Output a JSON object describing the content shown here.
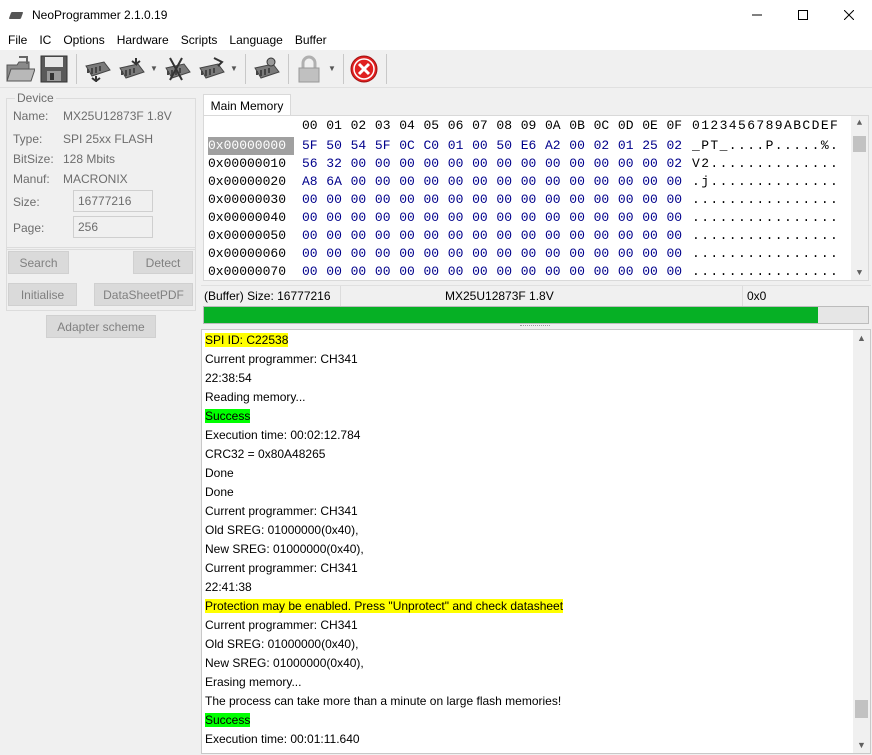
{
  "window": {
    "title": "NeoProgrammer 2.1.0.19"
  },
  "menu": [
    "File",
    "IC",
    "Options",
    "Hardware",
    "Scripts",
    "Language",
    "Buffer"
  ],
  "toolbar_icons": [
    "open-folder-icon",
    "save-icon",
    "read-chip-icon",
    "write-chip-icon",
    "verify-chip-icon",
    "erase-chip-icon",
    "chip-gear-icon",
    "unprotect-lock-icon",
    "stop-icon"
  ],
  "device": {
    "legend": "Device",
    "name_label": "Name:",
    "name": "MX25U12873F 1.8V",
    "type_label": "Type:",
    "type": "SPI 25xx FLASH",
    "bitsize_label": "BitSize:",
    "bitsize": "128 Mbits",
    "manuf_label": "Manuf:",
    "manuf": "MACRONIX",
    "size_label": "Size:",
    "size": "16777216",
    "page_label": "Page:",
    "page": "256"
  },
  "buttons": {
    "search": "Search",
    "detect": "Detect",
    "initialise": "Initialise",
    "datasheet": "DataSheetPDF",
    "adapter": "Adapter scheme"
  },
  "tabs": {
    "main_memory": "Main Memory"
  },
  "hex": {
    "header": [
      "00",
      "01",
      "02",
      "03",
      "04",
      "05",
      "06",
      "07",
      "08",
      "09",
      "0A",
      "0B",
      "0C",
      "0D",
      "0E",
      "0F"
    ],
    "ascii_header": "0123456789ABCDEF",
    "rows": [
      {
        "addr": "0x00000000",
        "bytes": [
          "5F",
          "50",
          "54",
          "5F",
          "0C",
          "C0",
          "01",
          "00",
          "50",
          "E6",
          "A2",
          "00",
          "02",
          "01",
          "25",
          "02"
        ],
        "ascii": "_PT_....P.....%."
      },
      {
        "addr": "0x00000010",
        "bytes": [
          "56",
          "32",
          "00",
          "00",
          "00",
          "00",
          "00",
          "00",
          "00",
          "00",
          "00",
          "00",
          "00",
          "00",
          "00",
          "02"
        ],
        "ascii": "V2.............."
      },
      {
        "addr": "0x00000020",
        "bytes": [
          "A8",
          "6A",
          "00",
          "00",
          "00",
          "00",
          "00",
          "00",
          "00",
          "00",
          "00",
          "00",
          "00",
          "00",
          "00",
          "00"
        ],
        "ascii": ".j.............."
      },
      {
        "addr": "0x00000030",
        "bytes": [
          "00",
          "00",
          "00",
          "00",
          "00",
          "00",
          "00",
          "00",
          "00",
          "00",
          "00",
          "00",
          "00",
          "00",
          "00",
          "00"
        ],
        "ascii": "................"
      },
      {
        "addr": "0x00000040",
        "bytes": [
          "00",
          "00",
          "00",
          "00",
          "00",
          "00",
          "00",
          "00",
          "00",
          "00",
          "00",
          "00",
          "00",
          "00",
          "00",
          "00"
        ],
        "ascii": "................"
      },
      {
        "addr": "0x00000050",
        "bytes": [
          "00",
          "00",
          "00",
          "00",
          "00",
          "00",
          "00",
          "00",
          "00",
          "00",
          "00",
          "00",
          "00",
          "00",
          "00",
          "00"
        ],
        "ascii": "................"
      },
      {
        "addr": "0x00000060",
        "bytes": [
          "00",
          "00",
          "00",
          "00",
          "00",
          "00",
          "00",
          "00",
          "00",
          "00",
          "00",
          "00",
          "00",
          "00",
          "00",
          "00"
        ],
        "ascii": "................"
      },
      {
        "addr": "0x00000070",
        "bytes": [
          "00",
          "00",
          "00",
          "00",
          "00",
          "00",
          "00",
          "00",
          "00",
          "00",
          "00",
          "00",
          "00",
          "00",
          "00",
          "00"
        ],
        "ascii": "................"
      }
    ]
  },
  "status": {
    "buffer_size": "(Buffer) Size: 16777216",
    "chip": "MX25U12873F 1.8V",
    "offset": "0x0"
  },
  "progress": {
    "fraction": 0.925
  },
  "log": [
    {
      "text": "SPI ID: C22538",
      "hl": "yellow"
    },
    {
      "text": "Current programmer: CH341",
      "hl": ""
    },
    {
      "text": "22:38:54",
      "hl": ""
    },
    {
      "text": "Reading memory...",
      "hl": ""
    },
    {
      "text": "Success",
      "hl": "green"
    },
    {
      "text": "Execution time: 00:02:12.784",
      "hl": ""
    },
    {
      "text": "CRC32 = 0x80A48265",
      "hl": ""
    },
    {
      "text": "Done",
      "hl": ""
    },
    {
      "text": "Done",
      "hl": ""
    },
    {
      "text": "Current programmer: CH341",
      "hl": ""
    },
    {
      "text": "Old SREG: 01000000(0x40),",
      "hl": ""
    },
    {
      "text": "New SREG: 01000000(0x40),",
      "hl": ""
    },
    {
      "text": "Current programmer: CH341",
      "hl": ""
    },
    {
      "text": "22:41:38",
      "hl": ""
    },
    {
      "text": "Protection may be enabled. Press \"Unprotect\" and check datasheet",
      "hl": "yellow"
    },
    {
      "text": "Current programmer: CH341",
      "hl": ""
    },
    {
      "text": "Old SREG: 01000000(0x40),",
      "hl": ""
    },
    {
      "text": "New SREG: 01000000(0x40),",
      "hl": ""
    },
    {
      "text": "Erasing memory...",
      "hl": ""
    },
    {
      "text": "The process can take more than a minute on large flash memories!",
      "hl": ""
    },
    {
      "text": "Success",
      "hl": "green"
    },
    {
      "text": "Execution time: 00:01:11.640",
      "hl": ""
    }
  ]
}
